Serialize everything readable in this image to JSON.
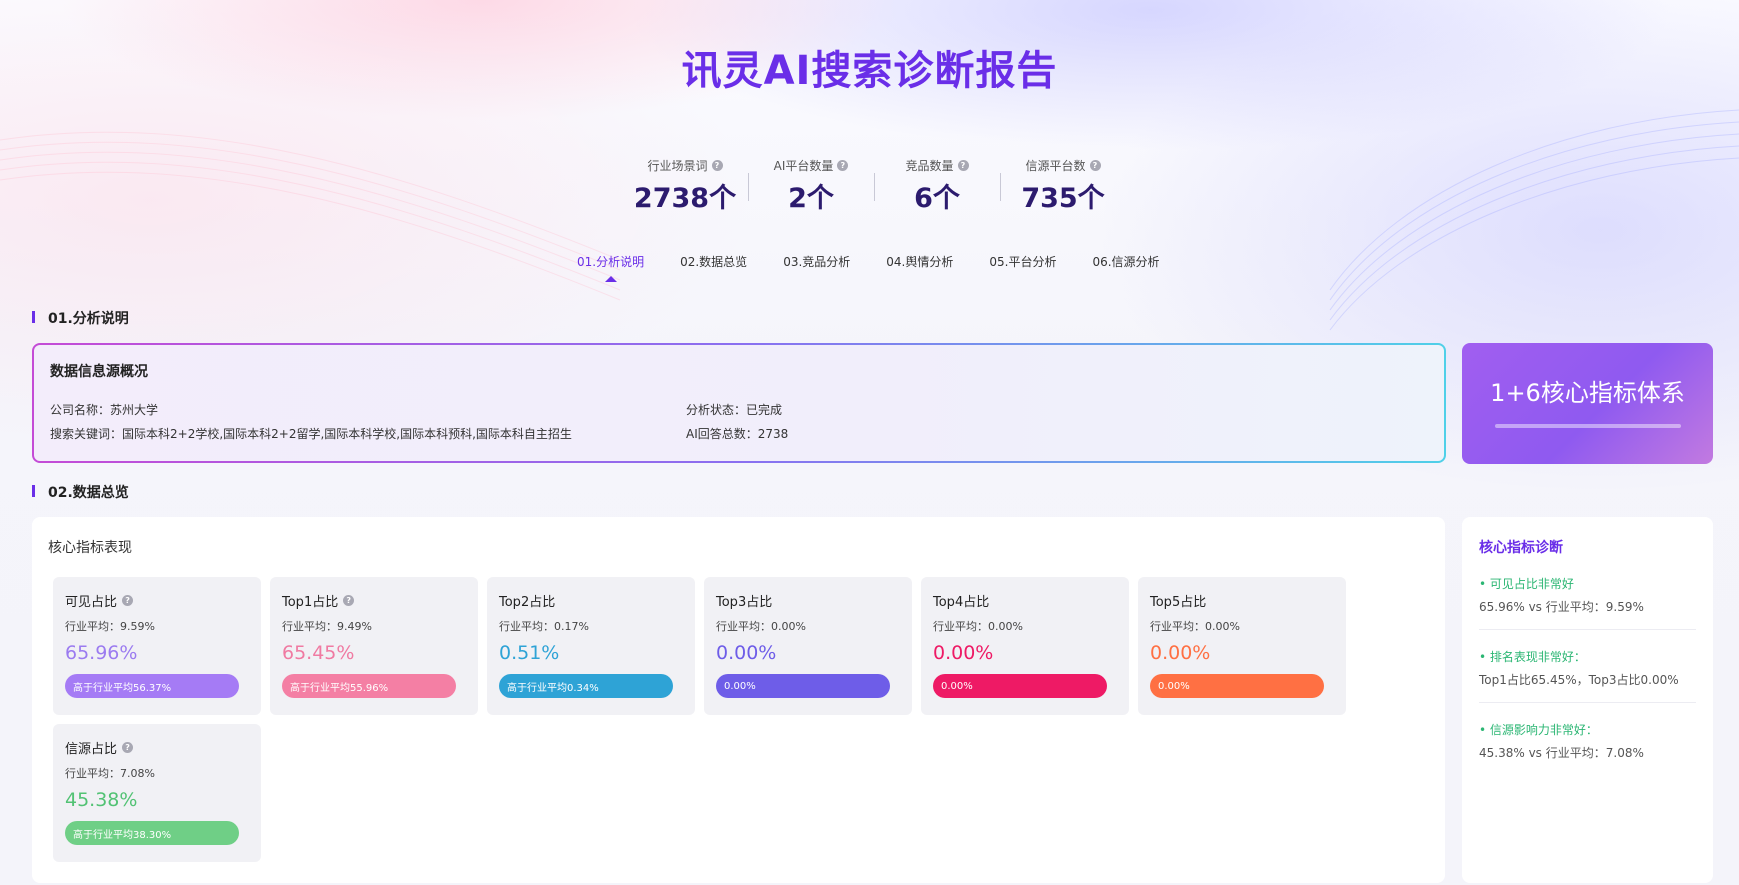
{
  "header": {
    "title": "讯灵AI搜索诊断报告"
  },
  "stats": [
    {
      "label": "行业场景词",
      "value": "2738个"
    },
    {
      "label": "AI平台数量",
      "value": "2个"
    },
    {
      "label": "竞品数量",
      "value": "6个"
    },
    {
      "label": "信源平台数",
      "value": "735个"
    }
  ],
  "tabs": [
    {
      "label": "01.分析说明",
      "active": true
    },
    {
      "label": "02.数据总览"
    },
    {
      "label": "03.竞品分析"
    },
    {
      "label": "04.舆情分析"
    },
    {
      "label": "05.平台分析"
    },
    {
      "label": "06.信源分析"
    }
  ],
  "sections": {
    "s1": "01.分析说明",
    "s2": "02.数据总览"
  },
  "info": {
    "title": "数据信息源概况",
    "company": "公司名称：苏州大学",
    "keywords": "搜索关键词：国际本科2+2学校,国际本科2+2留学,国际本科学校,国际本科预科,国际本科自主招生",
    "status": "分析状态：已完成",
    "answers": "AI回答总数：2738"
  },
  "core_card": {
    "label": "1+6核心指标体系"
  },
  "overview": {
    "title": "核心指标表现",
    "metrics": [
      {
        "label": "可见占比",
        "help": true,
        "avg": "行业平均：9.59%",
        "value": "65.96%",
        "pill": "高于行业平均56.37%",
        "color": "#a57bf5",
        "value_color": "#9b7bf0"
      },
      {
        "label": "Top1占比",
        "help": true,
        "avg": "行业平均：9.49%",
        "value": "65.45%",
        "pill": "高于行业平均55.96%",
        "color": "#f47fa4",
        "value_color": "#f07aa2"
      },
      {
        "label": "Top2占比",
        "help": false,
        "avg": "行业平均：0.17%",
        "value": "0.51%",
        "pill": "高于行业平均0.34%",
        "color": "#2ea3d6",
        "value_color": "#2ea3d6"
      },
      {
        "label": "Top3占比",
        "help": false,
        "avg": "行业平均：0.00%",
        "value": "0.00%",
        "pill": "0.00%",
        "color": "#6e5de8",
        "value_color": "#6e5de8"
      },
      {
        "label": "Top4占比",
        "help": false,
        "avg": "行业平均：0.00%",
        "value": "0.00%",
        "pill": "0.00%",
        "color": "#ee1a65",
        "value_color": "#ee1a65"
      },
      {
        "label": "Top5占比",
        "help": false,
        "avg": "行业平均：0.00%",
        "value": "0.00%",
        "pill": "0.00%",
        "color": "#ff7043",
        "value_color": "#ff7043"
      },
      {
        "label": "信源占比",
        "help": true,
        "avg": "行业平均：7.08%",
        "value": "45.38%",
        "pill": "高于行业平均38.30%",
        "color": "#6fcf86",
        "value_color": "#52c274"
      }
    ]
  },
  "diagnosis": {
    "title": "核心指标诊断",
    "items": [
      {
        "head": "• 可见占比非常好",
        "body": "65.96% vs 行业平均：9.59%"
      },
      {
        "head": "• 排名表现非常好：",
        "body": "Top1占比65.45%，Top3占比0.00%"
      },
      {
        "head": "• 信源影响力非常好：",
        "body": "45.38% vs 行业平均：7.08%"
      }
    ]
  }
}
